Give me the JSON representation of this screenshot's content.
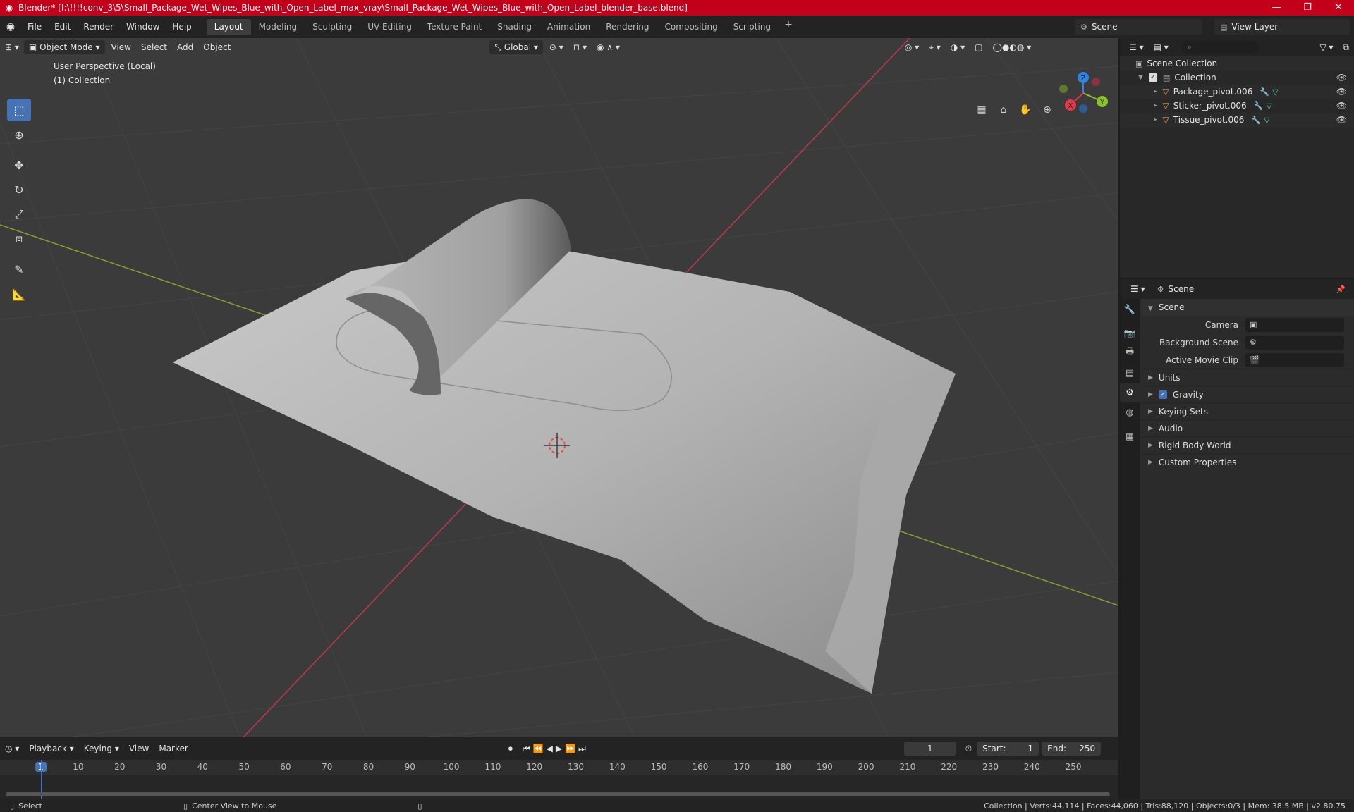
{
  "window": {
    "title": "Blender* [I:\\!!!!conv_3\\5\\Small_Package_Wet_Wipes_Blue_with_Open_Label_max_vray\\Small_Package_Wet_Wipes_Blue_with_Open_Label_blender_base.blend]",
    "controls": [
      "—",
      "❐",
      "✕"
    ]
  },
  "menu": {
    "items": [
      "File",
      "Edit",
      "Render",
      "Window",
      "Help"
    ],
    "workspaces": [
      "Layout",
      "Modeling",
      "Sculpting",
      "UV Editing",
      "Texture Paint",
      "Shading",
      "Animation",
      "Rendering",
      "Compositing",
      "Scripting"
    ],
    "active_workspace": "Layout",
    "scene": "Scene",
    "view_layer": "View Layer"
  },
  "viewport": {
    "mode": "Object Mode",
    "menus": [
      "View",
      "Select",
      "Add",
      "Object"
    ],
    "transform_orientation": "Global",
    "perspective": "User Perspective (Local)",
    "collection": "(1) Collection",
    "gizmo_axes": [
      "X",
      "Y",
      "Z"
    ]
  },
  "toolbar": {
    "tools": [
      "select-box",
      "cursor",
      "move",
      "rotate",
      "scale",
      "transform",
      "annotate",
      "measure"
    ]
  },
  "timeline": {
    "menus": [
      "Playback",
      "Keying",
      "View",
      "Marker"
    ],
    "current_frame": "1",
    "start_label": "Start:",
    "start": "1",
    "end_label": "End:",
    "end": "250",
    "ticks": [
      "1",
      "10",
      "20",
      "30",
      "40",
      "50",
      "60",
      "70",
      "80",
      "90",
      "100",
      "110",
      "120",
      "130",
      "140",
      "150",
      "160",
      "170",
      "180",
      "190",
      "200",
      "210",
      "220",
      "230",
      "240",
      "250"
    ]
  },
  "status": {
    "left": "Select",
    "middle": "Center View to Mouse",
    "right": "Collection | Verts:44,114 | Faces:44,060 | Tris:88,120 | Objects:0/3 | Mem: 38.5 MB | v2.80.75"
  },
  "outliner": {
    "root": "Scene Collection",
    "collection": "Collection",
    "objects": [
      "Package_pivot.006",
      "Sticker_pivot.006",
      "Tissue_pivot.006"
    ]
  },
  "properties": {
    "header": "Scene",
    "panel": "Scene",
    "fields": [
      {
        "label": "Camera",
        "value": ""
      },
      {
        "label": "Background Scene",
        "value": ""
      },
      {
        "label": "Active Movie Clip",
        "value": ""
      }
    ],
    "subpanels": [
      "Units",
      "Gravity",
      "Keying Sets",
      "Audio",
      "Rigid Body World",
      "Custom Properties"
    ]
  },
  "colors": {
    "title_bar": "#c3001a",
    "accent": "#4772b3",
    "axis_x": "#e23a4a",
    "axis_y": "#8ac02e",
    "axis_z": "#2f84e3"
  }
}
